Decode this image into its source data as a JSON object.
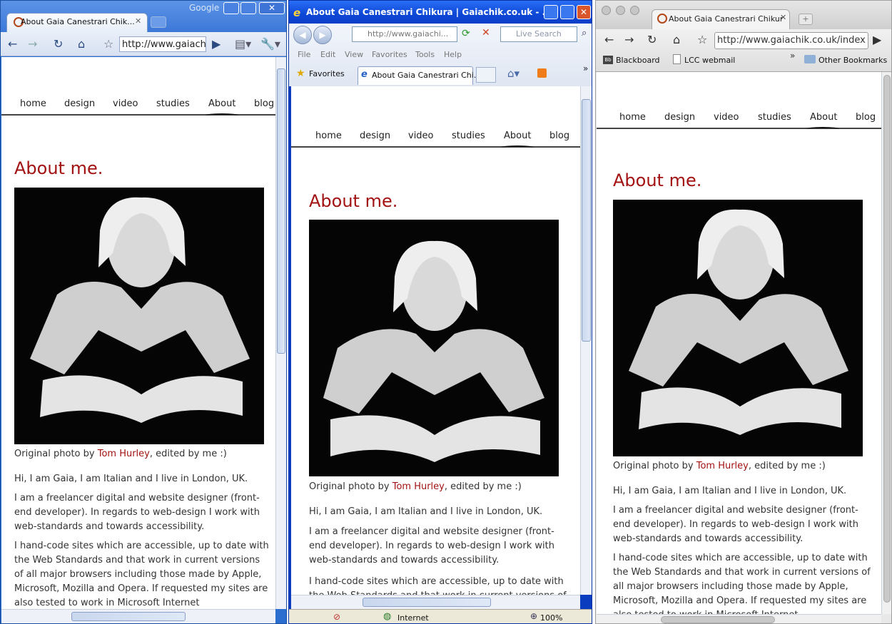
{
  "window1": {
    "titlebar_google": "Google",
    "tab_title": "About Gaia Canestrari Chik...",
    "address": "http://www.gaiach"
  },
  "window2": {
    "title": "About Gaia Canestrari Chikura | Gaiachik.co.uk - ...",
    "address": "http://www.gaiachi...",
    "search_placeholder": "Live Search",
    "menu": [
      "File",
      "Edit",
      "View",
      "Favorites",
      "Tools",
      "Help"
    ],
    "favorites": "Favorites",
    "tab_title": "About Gaia Canestrari Chi...",
    "status_zone": "Internet",
    "zoom": "100%"
  },
  "window3": {
    "tab_title": "About Gaia Canestrari Chikur",
    "address": "http://www.gaiachik.co.uk/index",
    "bookmarks": [
      "Blackboard",
      "LCC webmail"
    ],
    "other_bookmarks": "Other Bookmarks"
  },
  "page": {
    "nav": [
      "home",
      "design",
      "video",
      "studies",
      "About",
      "blog"
    ],
    "heading": "About me.",
    "caption_prefix": "Original photo by",
    "caption_link": "Tom Hurley",
    "caption_suffix": ", edited by me :)",
    "intro": "Hi, I am Gaia, I am Italian and I live in London, UK.",
    "p1": "I am a freelancer digital and website designer (front-end developer). In regards to web-design I work with web-standards and towards accessibility.",
    "p2": "I hand-code sites which are accessible, up to date with the Web Standards and that work in current versions of all major browsers including those made by Apple, Microsoft, Mozilla and Opera. If requested my sites are also tested to work in Microsoft Internet"
  },
  "colors": {
    "accent": "#a31212"
  }
}
